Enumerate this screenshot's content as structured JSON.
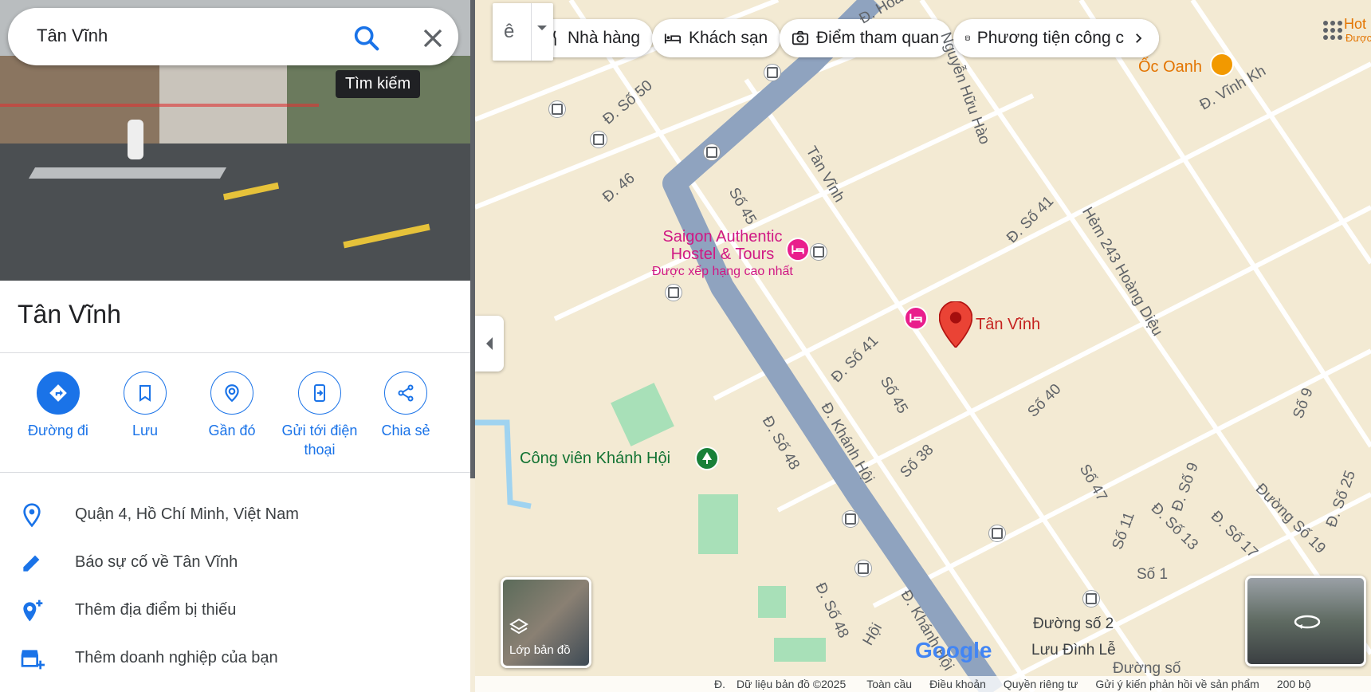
{
  "search": {
    "value": "Tân Vĩnh",
    "tooltip": "Tìm kiếm"
  },
  "place": {
    "title": "Tân Vĩnh"
  },
  "actions": [
    {
      "label": "Đường đi",
      "icon": "directions-icon"
    },
    {
      "label": "Lưu",
      "icon": "bookmark-icon"
    },
    {
      "label": "Gần đó",
      "icon": "nearby-icon"
    },
    {
      "label": "Gửi tới điện thoại",
      "icon": "send-to-phone-icon"
    },
    {
      "label": "Chia sẻ",
      "icon": "share-icon"
    }
  ],
  "info": [
    {
      "text": "Quận 4, Hồ Chí Minh, Việt Nam",
      "icon": "location-pin-icon"
    },
    {
      "text": "Báo sự cố về Tân Vĩnh",
      "icon": "pencil-icon"
    },
    {
      "text": "Thêm địa điểm bị thiếu",
      "icon": "add-place-icon"
    },
    {
      "text": "Thêm doanh nghiệp của bạn",
      "icon": "add-business-icon"
    }
  ],
  "map": {
    "chips": [
      "Nhà hàng",
      "Khách sạn",
      "Điểm tham quan",
      "Phương tiện công c"
    ],
    "marker_label": "Tân Vĩnh",
    "hostel": {
      "name_line1": "Saigon Authentic",
      "name_line2": "Hostel & Tours",
      "subtitle": "Được xếp hạng cao nhất"
    },
    "park": "Công viên Khánh Hội",
    "restaurant": "Ốc Oanh",
    "corner_text_1": "Hot",
    "corner_text_2": "Được",
    "streets": [
      "Đ. Số 50",
      "Đ. 46",
      "Số 45",
      "Tân Vĩnh",
      "Đ. Số 41",
      "Hẻm 243 Hoàng Diệu",
      "Đ. Số 41",
      "Số 45",
      "Đ. Khánh Hội",
      "Đ. Số 48",
      "Số 38",
      "Số 40",
      "Số 47",
      "Số 11",
      "Đ. Số 9",
      "Đ. Số 13",
      "Đ. Số 17",
      "Đường Số 19",
      "Đ. Số 25",
      "Số 9",
      "Số 1",
      "Đường số 2",
      "Lưu Đình Lễ",
      "Đường số",
      "Đ. Số 48",
      "Hội",
      "Đ. Khánh Hội",
      "Đ. Vĩnh Kh",
      "Nguyễn Hữu Hào",
      "Đ. Hoà"
    ],
    "layers_label": "Lớp bản đồ",
    "footer": [
      "Dữ liệu bản đồ ©2025",
      "Toàn cầu",
      "Điều khoản",
      "Quyền riêng tư",
      "Gửi ý kiến phản hồi về sản phẩm",
      "200 bộ"
    ],
    "footer_prefix": "Đ.",
    "google": "Google",
    "colors": {
      "road_major": "#8fa3bf",
      "road_minor": "#ffffff",
      "park": "#a8e0b8",
      "marker": "#ea4335",
      "accent": "#1a73e8"
    }
  }
}
